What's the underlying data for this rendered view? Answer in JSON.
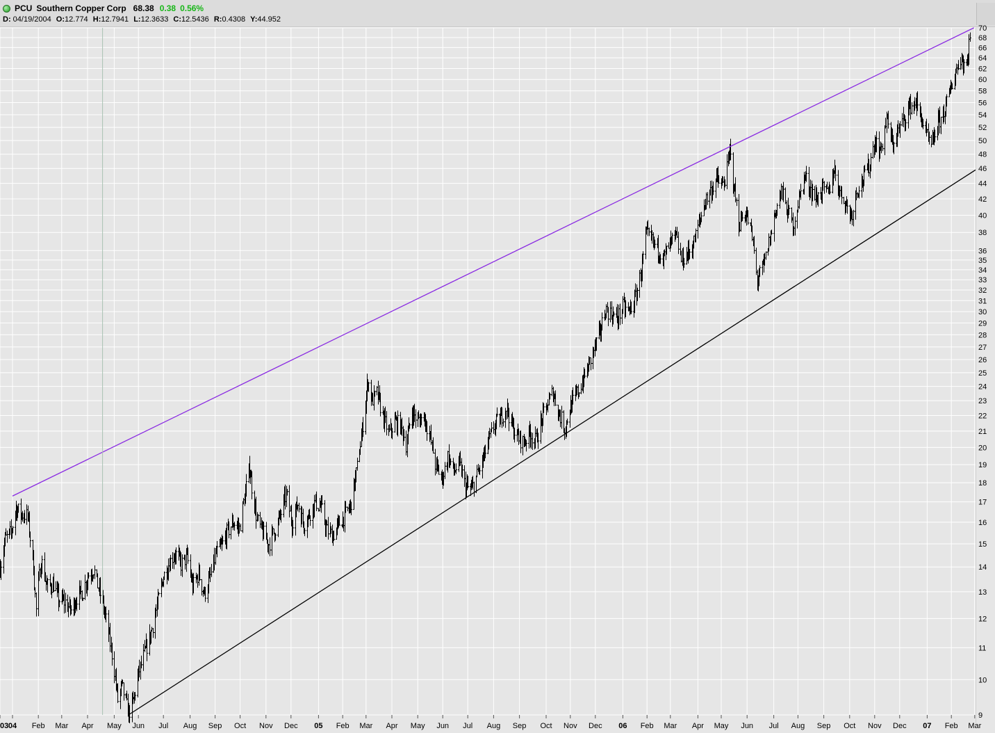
{
  "header": {
    "symbol": "PCU",
    "name": "Southern Copper Corp",
    "last": "68.38",
    "change": "0.38",
    "change_pct": "0.56%",
    "up_color": "#17b617",
    "status_icon": "green-circle-icon",
    "ohlc": {
      "d_label": "D:",
      "d": "04/19/2004",
      "o_label": "O:",
      "o": "12.774",
      "h_label": "H:",
      "h": "12.7941",
      "l_label": "L:",
      "l": "12.3633",
      "c_label": "C:",
      "c": "12.5436",
      "r_label": "R:",
      "r": "0.4308",
      "y_label": "Y:",
      "y": "44.952"
    }
  },
  "chart_data": {
    "type": "ohlc",
    "scale": "log",
    "ylim": [
      9,
      70
    ],
    "grid": true,
    "xlim": [
      "2003-12-18",
      "2007-03-02"
    ],
    "cursor_date": "2004-04-19",
    "y_ticks": [
      9,
      10,
      11,
      12,
      13,
      14,
      15,
      16,
      17,
      18,
      19,
      20,
      21,
      22,
      23,
      24,
      25,
      26,
      27,
      28,
      29,
      30,
      31,
      32,
      33,
      34,
      35,
      36,
      38,
      40,
      42,
      44,
      46,
      48,
      50,
      52,
      54,
      56,
      58,
      60,
      62,
      64,
      66,
      68,
      70
    ],
    "x_ticks": [
      {
        "label": "03",
        "date": "2003-12-18",
        "bold": true
      },
      {
        "label": "04",
        "date": "2004-01-02",
        "bold": true
      },
      {
        "label": "Feb",
        "date": "2004-02-02"
      },
      {
        "label": "Mar",
        "date": "2004-03-01"
      },
      {
        "label": "Apr",
        "date": "2004-04-01"
      },
      {
        "label": "May",
        "date": "2004-05-03"
      },
      {
        "label": "Jun",
        "date": "2004-06-01"
      },
      {
        "label": "Jul",
        "date": "2004-07-01"
      },
      {
        "label": "Aug",
        "date": "2004-08-02"
      },
      {
        "label": "Sep",
        "date": "2004-09-01"
      },
      {
        "label": "Oct",
        "date": "2004-10-01"
      },
      {
        "label": "Nov",
        "date": "2004-11-01"
      },
      {
        "label": "Dec",
        "date": "2004-12-01"
      },
      {
        "label": "05",
        "date": "2005-01-03",
        "bold": true
      },
      {
        "label": "Feb",
        "date": "2005-02-01"
      },
      {
        "label": "Mar",
        "date": "2005-03-01"
      },
      {
        "label": "Apr",
        "date": "2005-04-01"
      },
      {
        "label": "May",
        "date": "2005-05-02"
      },
      {
        "label": "Jun",
        "date": "2005-06-01"
      },
      {
        "label": "Jul",
        "date": "2005-07-01"
      },
      {
        "label": "Aug",
        "date": "2005-08-01"
      },
      {
        "label": "Sep",
        "date": "2005-09-01"
      },
      {
        "label": "Oct",
        "date": "2005-10-03"
      },
      {
        "label": "Nov",
        "date": "2005-11-01"
      },
      {
        "label": "Dec",
        "date": "2005-12-01"
      },
      {
        "label": "06",
        "date": "2006-01-03",
        "bold": true
      },
      {
        "label": "Feb",
        "date": "2006-02-01"
      },
      {
        "label": "Mar",
        "date": "2006-03-01"
      },
      {
        "label": "Apr",
        "date": "2006-04-03"
      },
      {
        "label": "May",
        "date": "2006-05-01"
      },
      {
        "label": "Jun",
        "date": "2006-06-01"
      },
      {
        "label": "Jul",
        "date": "2006-07-03"
      },
      {
        "label": "Aug",
        "date": "2006-08-01"
      },
      {
        "label": "Sep",
        "date": "2006-09-01"
      },
      {
        "label": "Oct",
        "date": "2006-10-02"
      },
      {
        "label": "Nov",
        "date": "2006-11-01"
      },
      {
        "label": "Dec",
        "date": "2006-12-01"
      },
      {
        "label": "07",
        "date": "2007-01-03",
        "bold": true
      },
      {
        "label": "Feb",
        "date": "2007-02-01"
      },
      {
        "label": "Mar",
        "date": "2007-03-01"
      }
    ],
    "close_path": [
      [
        "2003-12-18",
        14.0
      ],
      [
        "2003-12-24",
        15.2
      ],
      [
        "2003-12-31",
        15.5
      ],
      [
        "2004-01-06",
        16.7
      ],
      [
        "2004-01-12",
        16.4
      ],
      [
        "2004-01-20",
        16.3
      ],
      [
        "2004-01-27",
        14.0
      ],
      [
        "2004-01-30",
        12.3
      ],
      [
        "2004-02-05",
        14.3
      ],
      [
        "2004-02-12",
        13.2
      ],
      [
        "2004-02-20",
        13.3
      ],
      [
        "2004-02-26",
        12.7
      ],
      [
        "2004-03-05",
        12.6
      ],
      [
        "2004-03-12",
        12.3
      ],
      [
        "2004-03-19",
        12.8
      ],
      [
        "2004-03-26",
        13.0
      ],
      [
        "2004-04-02",
        13.7
      ],
      [
        "2004-04-08",
        13.9
      ],
      [
        "2004-04-19",
        12.54
      ],
      [
        "2004-04-26",
        11.5
      ],
      [
        "2004-05-03",
        10.3
      ],
      [
        "2004-05-07",
        9.4
      ],
      [
        "2004-05-12",
        9.8
      ],
      [
        "2004-05-20",
        9.05
      ],
      [
        "2004-05-26",
        9.4
      ],
      [
        "2004-06-01",
        10.2
      ],
      [
        "2004-06-08",
        10.8
      ],
      [
        "2004-06-15",
        11.4
      ],
      [
        "2004-06-22",
        12.3
      ],
      [
        "2004-06-30",
        13.5
      ],
      [
        "2004-07-08",
        14.2
      ],
      [
        "2004-07-15",
        14.6
      ],
      [
        "2004-07-22",
        14.1
      ],
      [
        "2004-07-29",
        14.4
      ],
      [
        "2004-08-05",
        13.2
      ],
      [
        "2004-08-12",
        13.7
      ],
      [
        "2004-08-19",
        12.9
      ],
      [
        "2004-08-26",
        13.6
      ],
      [
        "2004-09-02",
        14.6
      ],
      [
        "2004-09-09",
        14.9
      ],
      [
        "2004-09-16",
        15.6
      ],
      [
        "2004-09-23",
        16.0
      ],
      [
        "2004-09-30",
        15.7
      ],
      [
        "2004-10-07",
        17.5
      ],
      [
        "2004-10-12",
        18.9
      ],
      [
        "2004-10-15",
        17.8
      ],
      [
        "2004-10-21",
        16.1
      ],
      [
        "2004-10-28",
        15.5
      ],
      [
        "2004-11-04",
        15.0
      ],
      [
        "2004-11-11",
        15.6
      ],
      [
        "2004-11-18",
        16.3
      ],
      [
        "2004-11-25",
        17.4
      ],
      [
        "2004-12-02",
        16.0
      ],
      [
        "2004-12-09",
        16.9
      ],
      [
        "2004-12-16",
        15.9
      ],
      [
        "2004-12-23",
        16.4
      ],
      [
        "2004-12-30",
        17.0
      ],
      [
        "2005-01-06",
        16.7
      ],
      [
        "2005-01-13",
        15.6
      ],
      [
        "2005-01-20",
        15.4
      ],
      [
        "2005-01-27",
        15.9
      ],
      [
        "2005-02-03",
        16.3
      ],
      [
        "2005-02-10",
        16.8
      ],
      [
        "2005-02-17",
        18.5
      ],
      [
        "2005-02-24",
        21.0
      ],
      [
        "2005-03-03",
        24.5
      ],
      [
        "2005-03-08",
        23.0
      ],
      [
        "2005-03-14",
        23.5
      ],
      [
        "2005-03-21",
        22.0
      ],
      [
        "2005-03-28",
        20.8
      ],
      [
        "2005-04-04",
        21.6
      ],
      [
        "2005-04-11",
        21.4
      ],
      [
        "2005-04-18",
        20.2
      ],
      [
        "2005-04-25",
        22.3
      ],
      [
        "2005-05-02",
        21.6
      ],
      [
        "2005-05-09",
        22.0
      ],
      [
        "2005-05-16",
        20.8
      ],
      [
        "2005-05-23",
        19.0
      ],
      [
        "2005-05-31",
        18.2
      ],
      [
        "2005-06-07",
        19.5
      ],
      [
        "2005-06-14",
        18.6
      ],
      [
        "2005-06-21",
        19.0
      ],
      [
        "2005-06-28",
        17.8
      ],
      [
        "2005-07-05",
        17.6
      ],
      [
        "2005-07-12",
        18.4
      ],
      [
        "2005-07-19",
        19.3
      ],
      [
        "2005-07-26",
        20.4
      ],
      [
        "2005-08-02",
        21.4
      ],
      [
        "2005-08-09",
        21.8
      ],
      [
        "2005-08-16",
        22.6
      ],
      [
        "2005-08-23",
        21.3
      ],
      [
        "2005-08-30",
        20.6
      ],
      [
        "2005-09-06",
        20.3
      ],
      [
        "2005-09-13",
        20.9
      ],
      [
        "2005-09-20",
        20.4
      ],
      [
        "2005-09-27",
        21.6
      ],
      [
        "2005-10-04",
        22.7
      ],
      [
        "2005-10-11",
        23.6
      ],
      [
        "2005-10-18",
        22.2
      ],
      [
        "2005-10-25",
        21.2
      ],
      [
        "2005-11-01",
        22.6
      ],
      [
        "2005-11-08",
        23.4
      ],
      [
        "2005-11-15",
        24.3
      ],
      [
        "2005-11-22",
        25.4
      ],
      [
        "2005-11-29",
        26.8
      ],
      [
        "2005-12-06",
        28.1
      ],
      [
        "2005-12-13",
        30.2
      ],
      [
        "2005-12-20",
        29.8
      ],
      [
        "2005-12-27",
        29.4
      ],
      [
        "2006-01-03",
        30.4
      ],
      [
        "2006-01-10",
        30.0
      ],
      [
        "2006-01-17",
        31.0
      ],
      [
        "2006-01-24",
        33.5
      ],
      [
        "2006-01-31",
        37.8
      ],
      [
        "2006-02-07",
        37.0
      ],
      [
        "2006-02-14",
        36.2
      ],
      [
        "2006-02-21",
        35.3
      ],
      [
        "2006-02-28",
        36.6
      ],
      [
        "2006-03-07",
        37.6
      ],
      [
        "2006-03-14",
        35.0
      ],
      [
        "2006-03-21",
        35.6
      ],
      [
        "2006-03-28",
        36.6
      ],
      [
        "2006-04-04",
        39.0
      ],
      [
        "2006-04-11",
        41.6
      ],
      [
        "2006-04-18",
        43.0
      ],
      [
        "2006-04-25",
        44.6
      ],
      [
        "2006-05-02",
        43.6
      ],
      [
        "2006-05-08",
        45.8
      ],
      [
        "2006-05-11",
        48.5
      ],
      [
        "2006-05-15",
        44.6
      ],
      [
        "2006-05-22",
        39.0
      ],
      [
        "2006-05-30",
        40.4
      ],
      [
        "2006-06-06",
        38.0
      ],
      [
        "2006-06-13",
        33.0
      ],
      [
        "2006-06-20",
        34.2
      ],
      [
        "2006-06-27",
        36.8
      ],
      [
        "2006-07-05",
        40.6
      ],
      [
        "2006-07-12",
        43.0
      ],
      [
        "2006-07-19",
        40.5
      ],
      [
        "2006-07-26",
        38.8
      ],
      [
        "2006-08-02",
        42.0
      ],
      [
        "2006-08-09",
        45.0
      ],
      [
        "2006-08-16",
        43.3
      ],
      [
        "2006-08-23",
        42.0
      ],
      [
        "2006-08-30",
        43.2
      ],
      [
        "2006-09-06",
        42.6
      ],
      [
        "2006-09-13",
        46.0
      ],
      [
        "2006-09-20",
        43.0
      ],
      [
        "2006-09-27",
        41.4
      ],
      [
        "2006-10-04",
        40.0
      ],
      [
        "2006-10-11",
        43.4
      ],
      [
        "2006-10-18",
        44.5
      ],
      [
        "2006-10-25",
        46.4
      ],
      [
        "2006-11-01",
        50.0
      ],
      [
        "2006-11-08",
        48.4
      ],
      [
        "2006-11-15",
        53.4
      ],
      [
        "2006-11-22",
        49.4
      ],
      [
        "2006-11-29",
        51.4
      ],
      [
        "2006-12-06",
        53.4
      ],
      [
        "2006-12-13",
        55.4
      ],
      [
        "2006-12-20",
        56.0
      ],
      [
        "2006-12-27",
        53.4
      ],
      [
        "2007-01-03",
        50.4
      ],
      [
        "2007-01-08",
        49.0
      ],
      [
        "2007-01-15",
        52.4
      ],
      [
        "2007-01-22",
        54.2
      ],
      [
        "2007-01-29",
        57.2
      ],
      [
        "2007-02-05",
        61.0
      ],
      [
        "2007-02-12",
        64.2
      ],
      [
        "2007-02-19",
        62.4
      ],
      [
        "2007-02-23",
        68.38
      ]
    ],
    "trendlines": [
      {
        "name": "upper-trendline",
        "color": "#8a2be2",
        "start": [
          "2004-01-02",
          17.3
        ],
        "end": [
          "2007-02-28",
          70.0
        ]
      },
      {
        "name": "lower-trendline",
        "color": "#000000",
        "start": [
          "2004-05-20",
          9.0
        ],
        "end": [
          "2007-03-02",
          45.8
        ]
      }
    ]
  }
}
